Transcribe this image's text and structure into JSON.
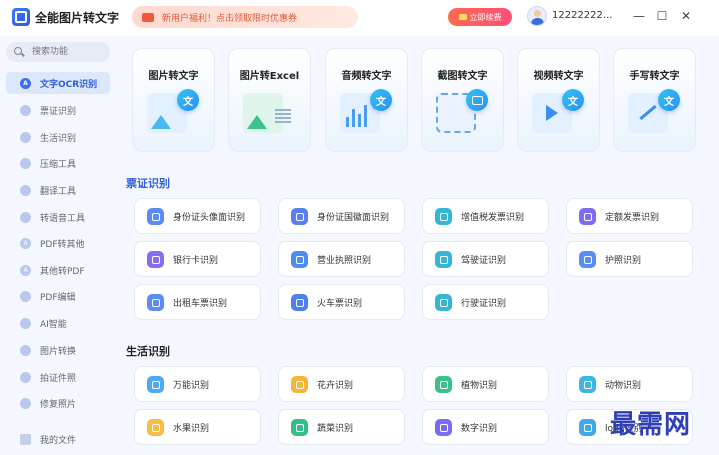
{
  "app": {
    "title": "全能图片转文字",
    "promo_text": "新用户福利！点击领取限时优惠券",
    "vip_label": "立即续费",
    "username": "12222222..."
  },
  "window": {
    "minimize": "—",
    "maximize": "☐",
    "close": "✕"
  },
  "sidebar": {
    "search_placeholder": "搜索功能",
    "items": [
      {
        "label": "文字OCR识别",
        "icon": "ocr-icon",
        "active": true
      },
      {
        "label": "票证识别",
        "icon": "ticket-icon"
      },
      {
        "label": "生活识别",
        "icon": "life-icon"
      },
      {
        "label": "压缩工具",
        "icon": "compress-icon"
      },
      {
        "label": "翻译工具",
        "icon": "translate-icon"
      },
      {
        "label": "转语音工具",
        "icon": "voice-icon"
      },
      {
        "label": "PDF转其他",
        "icon": "pdf-convert-icon"
      },
      {
        "label": "其他转PDF",
        "icon": "to-pdf-icon"
      },
      {
        "label": "PDF编辑",
        "icon": "pdf-edit-icon"
      },
      {
        "label": "AI智能",
        "icon": "ai-icon"
      },
      {
        "label": "图片转换",
        "icon": "image-convert-icon"
      },
      {
        "label": "拍证件照",
        "icon": "id-photo-icon"
      },
      {
        "label": "修复照片",
        "icon": "repair-photo-icon"
      }
    ],
    "my_files": "我的文件"
  },
  "features": [
    {
      "title": "图片转文字",
      "badge": "文"
    },
    {
      "title": "图片转Excel",
      "badge": ""
    },
    {
      "title": "音频转文字",
      "badge": "文"
    },
    {
      "title": "截图转文字",
      "badge": ""
    },
    {
      "title": "视频转文字",
      "badge": "文"
    },
    {
      "title": "手写转文字",
      "badge": "文"
    }
  ],
  "sections": {
    "tickets": {
      "title": "票证识别",
      "items": [
        "身份证头像面识别",
        "身份证国徽面识别",
        "增值税发票识别",
        "定额发票识别",
        "银行卡识别",
        "营业执照识别",
        "驾驶证识别",
        "护照识别",
        "出租车票识别",
        "火车票识别",
        "行驶证识别"
      ]
    },
    "life": {
      "title": "生活识别",
      "items": [
        "万能识别",
        "花卉识别",
        "植物识别",
        "动物识别",
        "水果识别",
        "蔬菜识别",
        "数字识别",
        "logo识别"
      ]
    }
  },
  "colors": {
    "accent": "#2f5fe0",
    "promo": "#e05b3a",
    "vip": "#ff5a60"
  },
  "watermark": "最需网"
}
